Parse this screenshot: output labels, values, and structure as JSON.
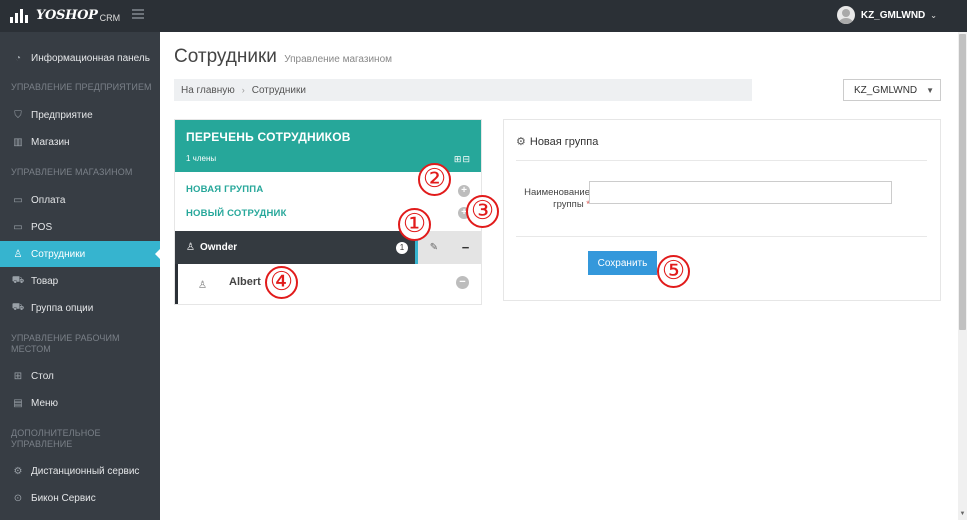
{
  "brand": {
    "name": "YOSHOP",
    "suffix": "CRM"
  },
  "header": {
    "user_name": "KZ_GMLWND",
    "user_caret": "⌄"
  },
  "sidebar": {
    "items": [
      {
        "label": "Информационная панель",
        "icon": "dashboard-icon"
      },
      {
        "label": "Предприятие",
        "icon": "shield-icon"
      },
      {
        "label": "Магазин",
        "icon": "book-icon"
      },
      {
        "label": "Оплата",
        "icon": "card-icon"
      },
      {
        "label": "POS",
        "icon": "card-icon"
      },
      {
        "label": "Сотрудники",
        "icon": "users-icon",
        "active": true
      },
      {
        "label": "Товар",
        "icon": "cart-icon"
      },
      {
        "label": "Группа опции",
        "icon": "cart-icon"
      },
      {
        "label": "Стол",
        "icon": "grid-icon"
      },
      {
        "label": "Меню",
        "icon": "menu-book-icon"
      },
      {
        "label": "Дистанционный сервис",
        "icon": "gear-icon"
      },
      {
        "label": "Бикон Сервис",
        "icon": "location-pin-icon"
      }
    ],
    "sections": [
      "УПРАВЛЕНИЕ ПРЕДПРИЯТИЕМ",
      "УПРАВЛЕНИЕ МАГАЗИНОМ",
      "УПРАВЛЕНИЕ РАБОЧИМ МЕСТОМ",
      "ДОПОЛНИТЕЛЬНОЕ УПРАВЛЕНИЕ"
    ]
  },
  "page": {
    "title": "Сотрудники",
    "subtitle": "Управление магазином"
  },
  "breadcrumb": {
    "home": "На главную",
    "current": "Сотрудники"
  },
  "store_select": {
    "value": "KZ_GMLWND"
  },
  "employees": {
    "title": "ПЕРЕЧЕНЬ СОТРУДНИКОВ",
    "count": "1 члены",
    "new_group_link": "НОВАЯ ГРУППА",
    "new_employee_link": "НОВЫЙ СОТРУДНИК",
    "group": {
      "name": "Ownder",
      "badge": "1"
    },
    "members": [
      {
        "name": "Albert"
      }
    ]
  },
  "form": {
    "title": "Новая группа",
    "label": "Наименование группы",
    "required_mark": "*",
    "input_value": "",
    "save_label": "Сохранить"
  },
  "markers": [
    "①",
    "②",
    "③",
    "④",
    "⑤"
  ],
  "colors": {
    "topbar": "#2b3036",
    "sidebar": "#373d44",
    "active": "#36b4cf",
    "teal_header": "#26a79a",
    "save_button": "#3498db",
    "marker_red": "#e11b1b"
  }
}
